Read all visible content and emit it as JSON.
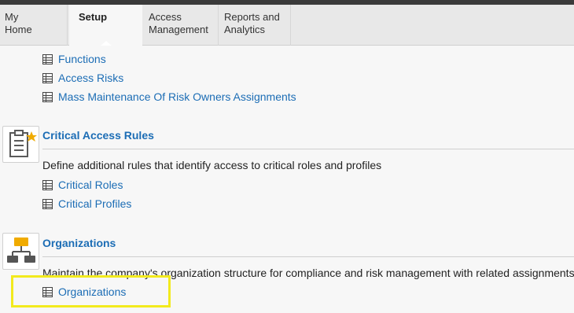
{
  "tabs": [
    {
      "label": "My\nHome"
    },
    {
      "label": "Setup"
    },
    {
      "label": "Access\nManagement"
    },
    {
      "label": "Reports and\nAnalytics"
    }
  ],
  "top_links": [
    "Functions",
    "Access Risks",
    "Mass Maintenance Of Risk Owners Assignments"
  ],
  "critical_access": {
    "title": "Critical Access Rules",
    "description": "Define additional rules that identify access to critical roles and profiles",
    "links": [
      "Critical Roles",
      "Critical Profiles"
    ]
  },
  "organizations": {
    "title": "Organizations",
    "description": "Maintain the company's organization structure for compliance and risk management with related assignments",
    "links": [
      "Organizations"
    ]
  },
  "colors": {
    "link": "#1c6db5",
    "highlight": "#f2ea1d",
    "org_icon": "#f0ab00",
    "org_icon_nodes": "#555555"
  },
  "icons": {
    "link": "table-icon",
    "critical_access": "clipboard-star-icon",
    "organizations": "org-chart-icon"
  }
}
